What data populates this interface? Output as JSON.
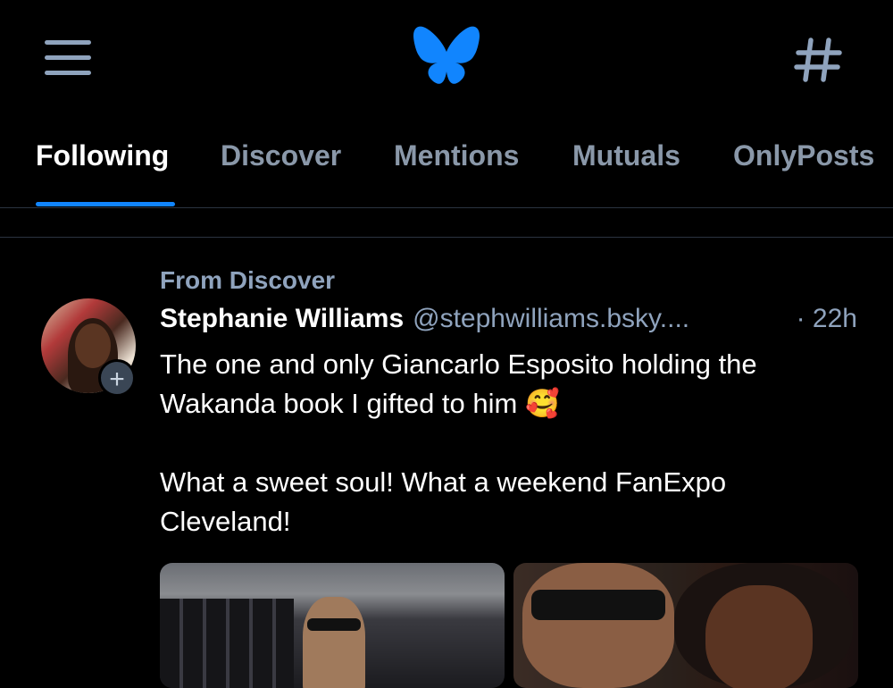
{
  "header": {
    "menu_icon": "hamburger-menu-icon",
    "logo_icon": "butterfly-logo-icon",
    "feeds_icon": "hashtag-icon",
    "brand_color": "#1185fe"
  },
  "tabs": [
    {
      "label": "Following",
      "active": true
    },
    {
      "label": "Discover",
      "active": false
    },
    {
      "label": "Mentions",
      "active": false
    },
    {
      "label": "Mutuals",
      "active": false
    },
    {
      "label": "OnlyPosts",
      "active": false
    }
  ],
  "post": {
    "reason": "From Discover",
    "author_name": "Stephanie Williams",
    "author_handle": "@stephwilliams.bsky....",
    "time": "· 22h",
    "text": "The one and only Giancarlo Esposito holding the\nWakanda book I gifted to him 🥰\n\nWhat a sweet soul! What a weekend FanExpo\nCleveland!",
    "follow_badge": "+",
    "images": [
      {
        "name": "post-image-1"
      },
      {
        "name": "post-image-2"
      }
    ]
  }
}
